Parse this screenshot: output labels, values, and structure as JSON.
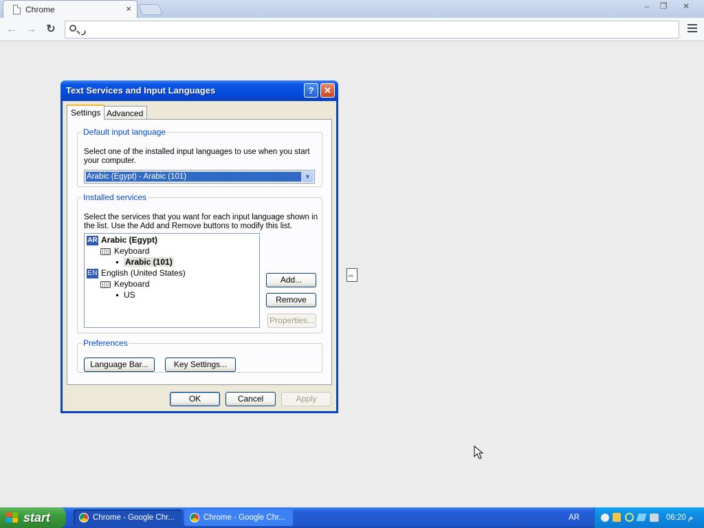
{
  "browser": {
    "tab_title": "Chrome",
    "tab_close": "×",
    "win_minimize": "–",
    "win_restore": "❐",
    "win_close": "✕",
    "back": "←",
    "forward": "→",
    "reload": "↻",
    "omnibox_text": "ر"
  },
  "dialog": {
    "title": "Text Services and Input Languages",
    "help_glyph": "?",
    "close_glyph": "✕",
    "tabs": [
      "Settings",
      "Advanced"
    ],
    "default_input": {
      "legend": "Default input language",
      "description": "Select one of the installed input languages to use when you start your computer.",
      "selected": "Arabic (Egypt) - Arabic (101)",
      "drop_glyph": "▼"
    },
    "installed": {
      "legend": "Installed services",
      "description": "Select the services that you want for each input language shown in the list. Use the Add and Remove buttons to modify this list.",
      "tree": {
        "lang1_badge": "AR",
        "lang1_name": "Arabic (Egypt)",
        "lang1_group": "Keyboard",
        "lang1_item": "Arabic (101)",
        "lang2_badge": "EN",
        "lang2_name": "English (United States)",
        "lang2_group": "Keyboard",
        "lang2_item": "US"
      },
      "add": "Add...",
      "remove": "Remove",
      "properties": "Properties..."
    },
    "preferences": {
      "legend": "Preferences",
      "language_bar": "Language Bar...",
      "key_settings": "Key Settings..."
    },
    "ok": "OK",
    "cancel": "Cancel",
    "apply": "Apply"
  },
  "taskbar": {
    "start": "start",
    "tasks": [
      "Chrome - Google Chr...",
      "Chrome - Google Chr..."
    ],
    "lang": "AR",
    "clock": "06:20 م"
  },
  "colors": {
    "taskbar": "#245edb",
    "start": "#3c9a3c",
    "tray": "#0f8fe6",
    "dialog_title": "#0a55e6"
  }
}
